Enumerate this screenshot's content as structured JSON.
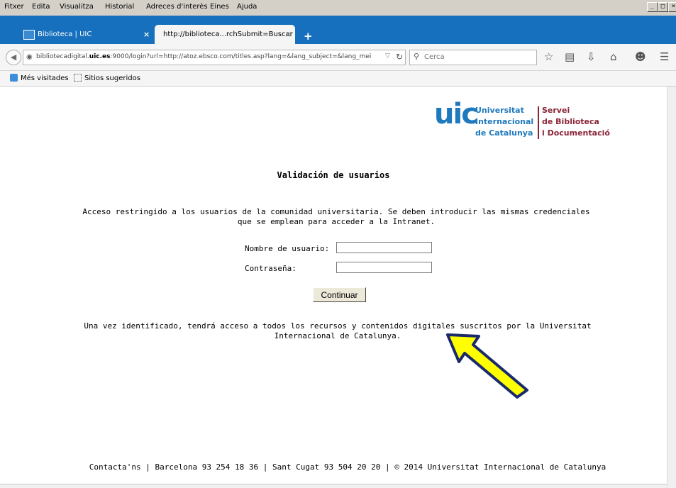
{
  "menubar": {
    "items": [
      "Fitxer",
      "Edita",
      "Visualitza",
      "Historial",
      "Adreces d'interès",
      "Eines",
      "Ajuda"
    ]
  },
  "window_controls": [
    "_",
    "□",
    "×"
  ],
  "tabs": [
    {
      "label": "Biblioteca | UIC",
      "close": "×",
      "active": false
    },
    {
      "label": "http://biblioteca...rchSubmit=Buscar",
      "close": "×",
      "active": true
    }
  ],
  "new_tab": "+",
  "navbar": {
    "url_host": "bibliotecadigital.uic.es",
    "url_host_prefix": "bibliotecadigital.",
    "url_host_bold": "uic.es",
    "url_rest": ":9000/login?url=http://atoz.ebsco.com/titles.asp?lang=&lang_subject=&lang_mei",
    "search_placeholder": "Cerca",
    "icons": [
      "back-icon",
      "globe-icon",
      "dropdown-icon",
      "reload-icon",
      "search-icon",
      "star-icon",
      "bookmarks-icon",
      "download-icon",
      "home-icon",
      "chat-icon",
      "menu-icon"
    ]
  },
  "bookmarks": [
    {
      "label": "Més visitades"
    },
    {
      "label": "Sitios sugeridos"
    }
  ],
  "logo": {
    "mark": "uic",
    "university": [
      "Universitat",
      "Internacional",
      "de Catalunya"
    ],
    "service": [
      "Servei",
      "de Biblioteca",
      "i Documentació"
    ],
    "colors": {
      "university": "#1f79bd",
      "service": "#8a2438"
    }
  },
  "page": {
    "title": "Validación de usuarios",
    "intro": "Acceso restringido a los usuarios de la comunidad universitaria. Se deben introducir las mismas credenciales que se emplean para acceder a la Intranet.",
    "username_label": "Nombre de usuario:",
    "username_value": "",
    "password_label": "Contraseña:",
    "password_value": "",
    "submit_label": "Continuar",
    "after_text": "Una vez identificado, tendrá acceso a todos los recursos y contenidos digitales suscritos por la Universitat Internacional de Catalunya.",
    "footer": "Contacta'ns | Barcelona 93 254 18 36 | Sant Cugat 93 504 20 20 | © 2014 Universitat Internacional de Catalunya"
  },
  "annotation": {
    "arrow_color": "#ffff00",
    "arrow_outline": "#1a2a6b"
  }
}
